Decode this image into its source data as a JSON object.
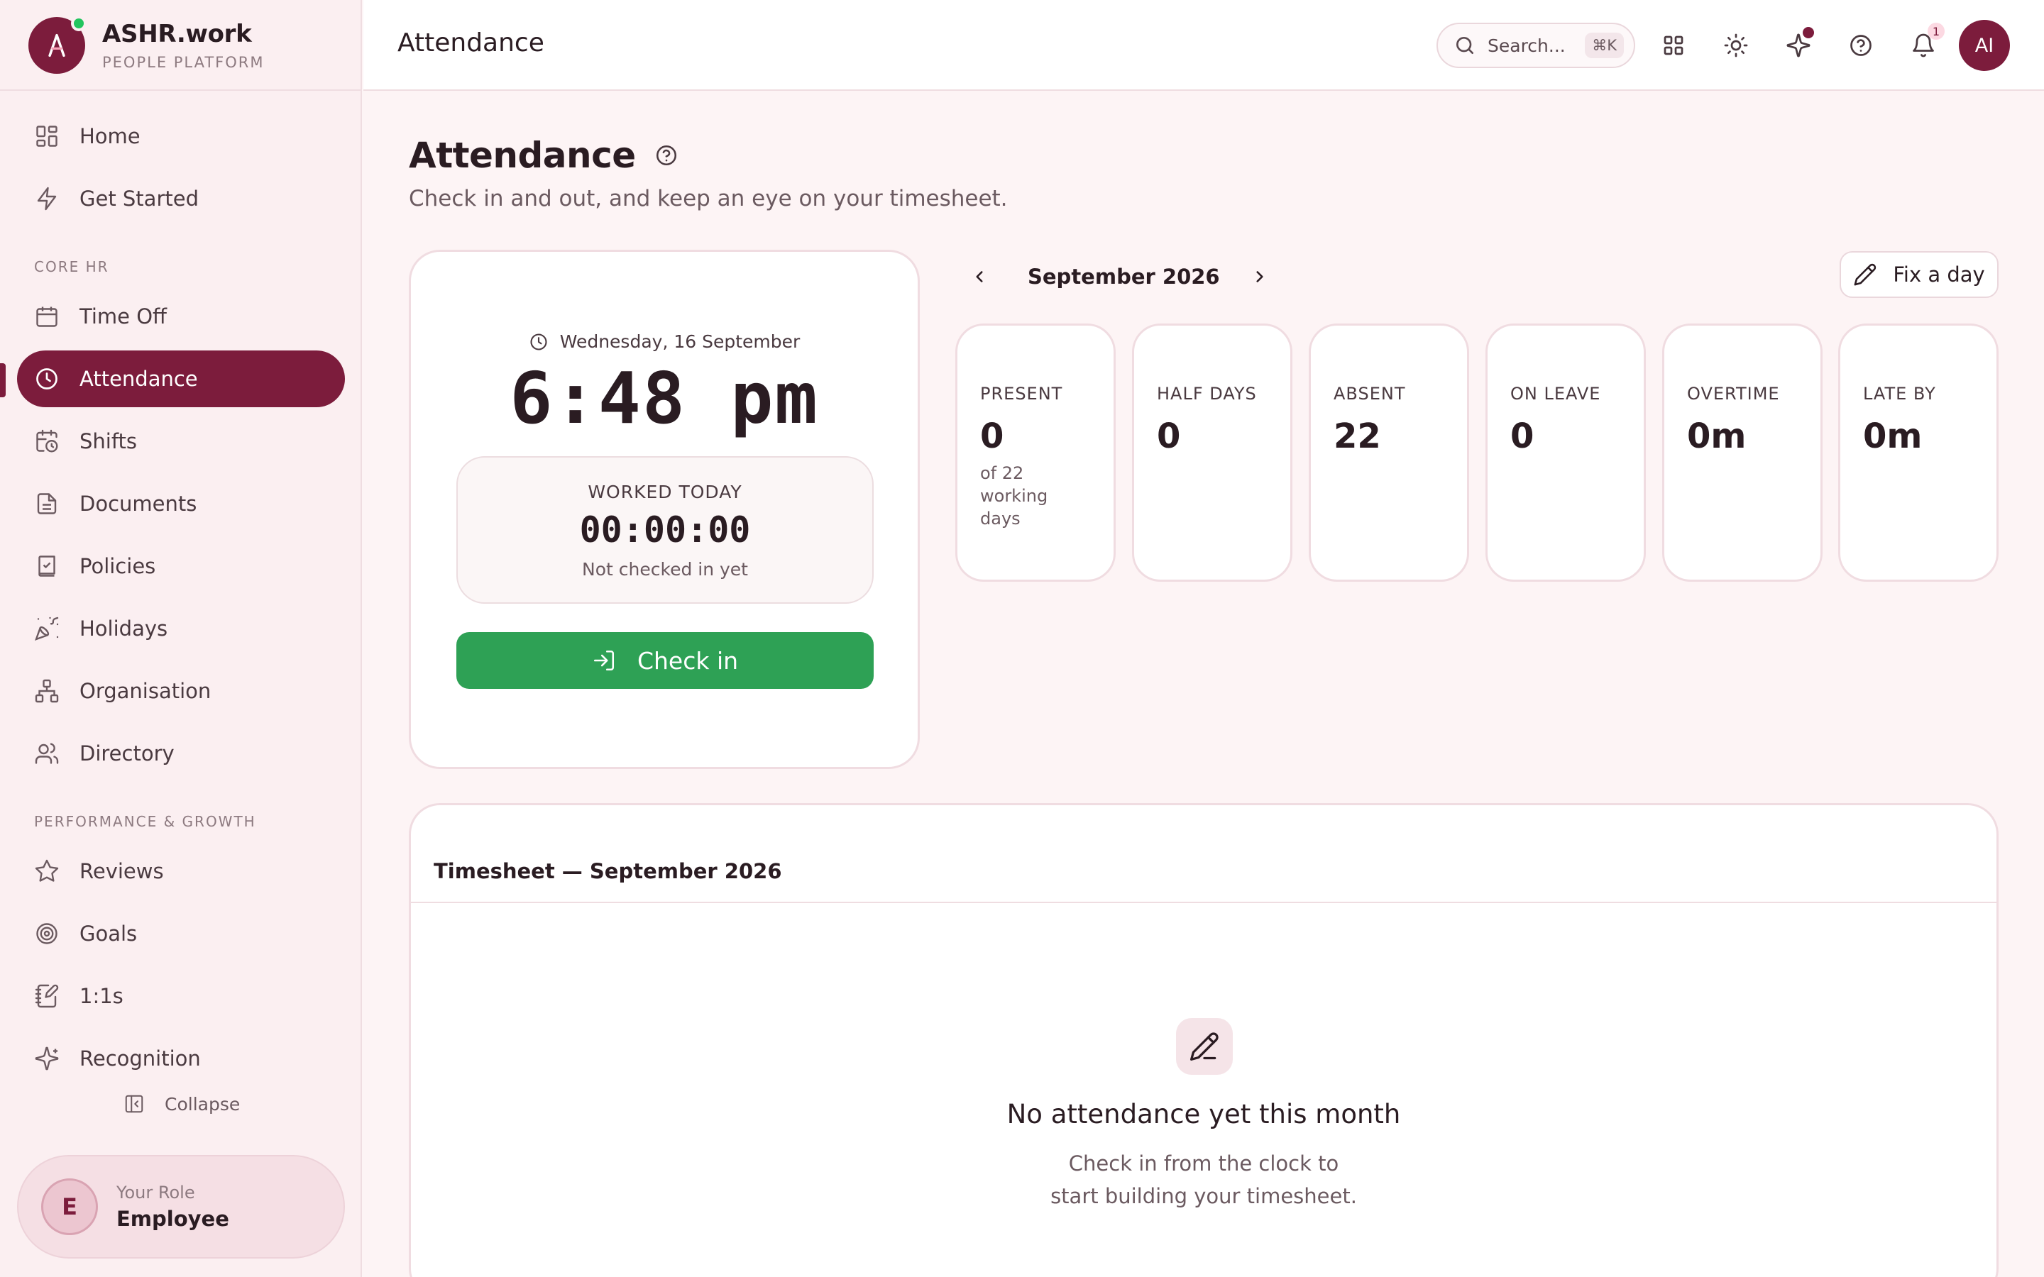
{
  "brand": {
    "name": "ASHR.work",
    "subtitle": "PEOPLE PLATFORM"
  },
  "sidebar": {
    "items": [
      {
        "label": "Home",
        "icon": "grid-icon"
      },
      {
        "label": "Get Started",
        "icon": "zap-icon"
      },
      {
        "label": "Time Off",
        "icon": "calendar-icon"
      },
      {
        "label": "Attendance",
        "icon": "clock-icon",
        "active": true
      },
      {
        "label": "Shifts",
        "icon": "calendar-clock-icon"
      },
      {
        "label": "Documents",
        "icon": "file-icon"
      },
      {
        "label": "Policies",
        "icon": "book-check-icon"
      },
      {
        "label": "Holidays",
        "icon": "party-icon"
      },
      {
        "label": "Organisation",
        "icon": "org-chart-icon"
      },
      {
        "label": "Directory",
        "icon": "users-icon"
      },
      {
        "label": "Reviews",
        "icon": "star-icon"
      },
      {
        "label": "Goals",
        "icon": "target-icon"
      },
      {
        "label": "1:1s",
        "icon": "notebook-pen-icon"
      },
      {
        "label": "Recognition",
        "icon": "sparkles-icon"
      }
    ],
    "sections": {
      "core_hr": "CORE HR",
      "performance": "PERFORMANCE & GROWTH"
    },
    "collapse_label": "Collapse",
    "role": {
      "initial": "E",
      "label": "Your Role",
      "value": "Employee"
    }
  },
  "topbar": {
    "title": "Attendance",
    "search_placeholder": "Search...",
    "search_shortcut": "⌘K",
    "notification_count": "1",
    "user_initials": "AI"
  },
  "page": {
    "title": "Attendance",
    "subtitle": "Check in and out, and keep an eye on your timesheet."
  },
  "clock": {
    "date": "Wednesday, 16 September",
    "time": "6:48 pm",
    "worked_label": "WORKED TODAY",
    "worked_value": "00:00:00",
    "status": "Not checked in yet",
    "check_in_label": "Check in"
  },
  "month_nav": {
    "label": "September 2026",
    "fix_label": "Fix a day"
  },
  "stats": [
    {
      "label": "PRESENT",
      "value": "0",
      "sub": "of 22 working days"
    },
    {
      "label": "HALF DAYS",
      "value": "0",
      "sub": ""
    },
    {
      "label": "ABSENT",
      "value": "22",
      "sub": ""
    },
    {
      "label": "ON LEAVE",
      "value": "0",
      "sub": ""
    },
    {
      "label": "OVERTIME",
      "value": "0m",
      "sub": ""
    },
    {
      "label": "LATE BY",
      "value": "0m",
      "sub": ""
    }
  ],
  "timesheet": {
    "title": "Timesheet — September 2026",
    "empty_title": "No attendance yet this month",
    "empty_line1": "Check in from the clock to",
    "empty_line2": "start building your timesheet."
  },
  "colors": {
    "brand": "#7c1c3c",
    "check_in": "#2ea155",
    "online": "#22c55e",
    "background": "#fdf4f5"
  }
}
